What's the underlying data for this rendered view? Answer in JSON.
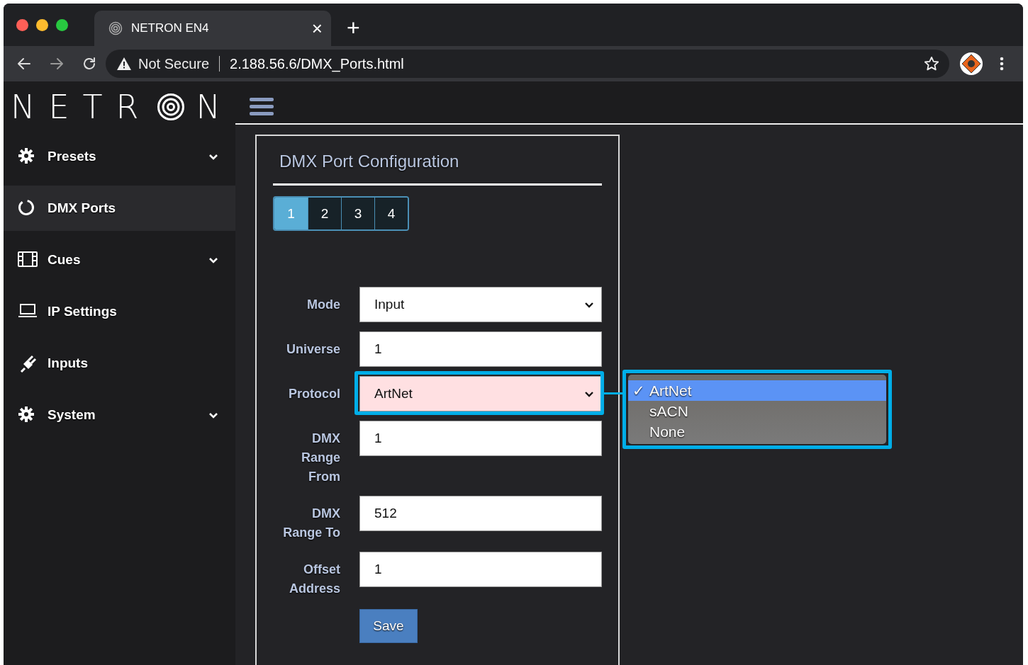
{
  "browser": {
    "tab": {
      "title": "NETRON EN4",
      "close": "×",
      "selected": true
    },
    "new_tab": "+",
    "address": {
      "security": "Not Secure",
      "url": "2.188.56.6/DMX_Ports.html"
    }
  },
  "logo": {
    "before": "NETR",
    "after": "N"
  },
  "sidebar": {
    "items": [
      {
        "label": "Presets",
        "kind": "gear",
        "expandable": true,
        "selected": false
      },
      {
        "label": "DMX Ports",
        "kind": "ring",
        "expandable": false,
        "selected": true
      },
      {
        "label": "Cues",
        "kind": "film",
        "expandable": true,
        "selected": false
      },
      {
        "label": "IP Settings",
        "kind": "laptop",
        "expandable": false,
        "selected": false
      },
      {
        "label": "Inputs",
        "kind": "plug",
        "expandable": false,
        "selected": false
      },
      {
        "label": "System",
        "kind": "gear",
        "expandable": true,
        "selected": false
      }
    ]
  },
  "panel": {
    "title": "DMX Port Configuration",
    "port_tabs": [
      {
        "label": "1",
        "selected": true
      },
      {
        "label": "2",
        "selected": false
      },
      {
        "label": "3",
        "selected": false
      },
      {
        "label": "4",
        "selected": false
      }
    ],
    "fields": [
      {
        "label": "Mode",
        "kind": "select",
        "value": "Input",
        "highlighted": false
      },
      {
        "label": "Universe",
        "kind": "text",
        "value": "1",
        "highlighted": false
      },
      {
        "label": "Protocol",
        "kind": "select",
        "value": "ArtNet",
        "highlighted": true
      },
      {
        "label": "DMX Range From",
        "kind": "text",
        "value": "1",
        "highlighted": false
      },
      {
        "label": "DMX Range To",
        "kind": "text",
        "value": "512",
        "highlighted": false
      },
      {
        "label": "Offset Address",
        "kind": "text",
        "value": "1",
        "highlighted": false
      }
    ],
    "save_button": "Save"
  },
  "dropdown": {
    "options": [
      {
        "label": "ArtNet",
        "mark": "✓",
        "selected": true
      },
      {
        "label": "sACN",
        "selected": false
      },
      {
        "label": "None",
        "selected": false
      }
    ]
  }
}
